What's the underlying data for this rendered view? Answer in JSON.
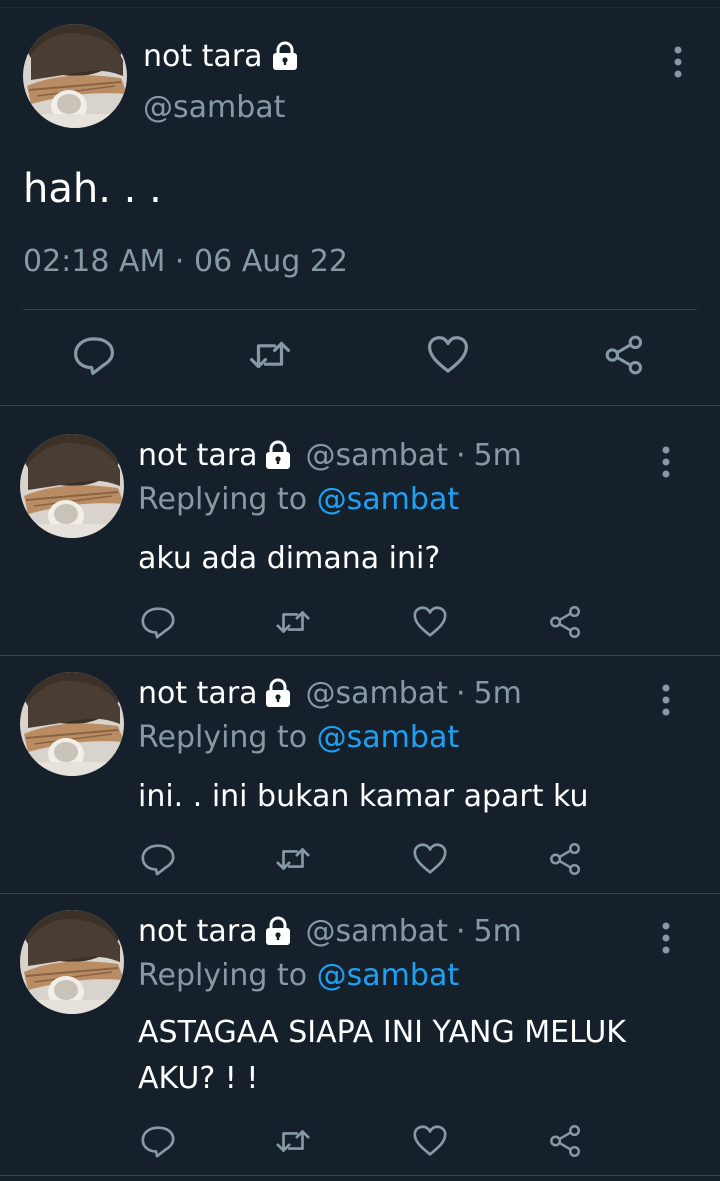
{
  "main_tweet": {
    "name": "not tara",
    "handle": "@sambat",
    "text": "hah. . .",
    "timestamp": "02:18 AM · 06 Aug 22"
  },
  "replies": [
    {
      "name": "not tara",
      "handle": "@sambat",
      "separator": "·",
      "ago": "5m",
      "replying_prefix": "Replying to ",
      "replying_to": "@sambat",
      "text": "aku ada dimana ini?"
    },
    {
      "name": "not tara",
      "handle": "@sambat",
      "separator": "·",
      "ago": "5m",
      "replying_prefix": "Replying to ",
      "replying_to": "@sambat",
      "text": "ini. .  ini bukan kamar apart ku"
    },
    {
      "name": "not tara",
      "handle": "@sambat",
      "separator": "·",
      "ago": "5m",
      "replying_prefix": "Replying to ",
      "replying_to": "@sambat",
      "text": "ASTAGAA SIAPA INI YANG MELUK AKU? ! !"
    }
  ],
  "icons": {
    "reply": "reply-icon",
    "retweet": "retweet-icon",
    "like": "heart-icon",
    "share": "share-icon",
    "lock": "lock-icon",
    "more": "more-vertical-icon"
  },
  "colors": {
    "background": "#15202b",
    "text_secondary": "#8899a6",
    "accent": "#1da1f2",
    "divider": "#38444d"
  }
}
